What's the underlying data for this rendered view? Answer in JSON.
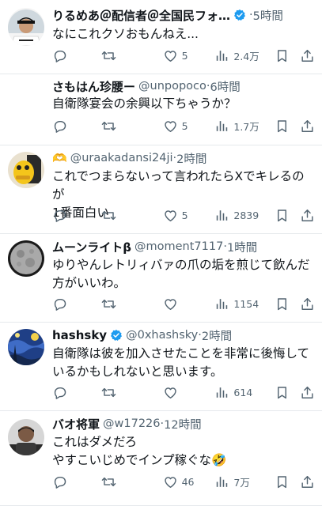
{
  "tweets": [
    {
      "name": "りるめあ＠配信者＠全国民フォ…",
      "verified": true,
      "name_emoji": "",
      "handle": "",
      "dot": "·",
      "time": "5時間",
      "text": "なにこれクソおもんねえ...",
      "replies": "",
      "retweets": "",
      "likes": "5",
      "views": "2.4万",
      "avatar_icon": "anime-character-avatar"
    },
    {
      "name": "さもはん珍腰ー",
      "verified": false,
      "name_emoji": "",
      "handle": "@unpopoco",
      "dot": "·",
      "time": "6時間",
      "text": "自衛隊宴会の余興以下ちゃうか？",
      "replies": "",
      "retweets": "",
      "likes": "5",
      "views": "1.7万",
      "avatar_icon": "baseball-player-avatar"
    },
    {
      "name": "",
      "verified": false,
      "name_emoji": "🫶",
      "handle": "@uraakadansi24ji",
      "dot": "·",
      "time": "2時間",
      "text": "これでつまらないって言われたらXでキレるのが\n1番面白い",
      "replies": "",
      "retweets": "",
      "likes": "5",
      "views": "2839",
      "avatar_icon": "yellow-character-avatar"
    },
    {
      "name": "ムーンライトβ",
      "verified": false,
      "name_emoji": "",
      "handle": "@moment7117",
      "dot": "·",
      "time": "1時間",
      "text": "ゆりやんレトリィバァの爪の垢を煎じて飲んだ\n方がいいわ。",
      "replies": "",
      "retweets": "",
      "likes": "",
      "views": "1154",
      "avatar_icon": "moon-avatar"
    },
    {
      "name": "hashsky",
      "verified": true,
      "name_emoji": "",
      "handle": "@0xhashsky",
      "dot": "·",
      "time": "2時間",
      "text": "自衛隊は彼を加入させたことを非常に後悔して\nいるかもしれないと思います。",
      "replies": "",
      "retweets": "",
      "likes": "",
      "views": "614",
      "avatar_icon": "starry-night-avatar"
    },
    {
      "name": "バオ将軍",
      "verified": false,
      "name_emoji": "",
      "handle": "@w17226",
      "dot": "·",
      "time": "12時間",
      "text": "これはダメだろ\nやすこいじめでインプ稼ぐな🤣",
      "replies": "",
      "retweets": "",
      "likes": "46",
      "views": "7万",
      "avatar_icon": "man-avatar"
    }
  ],
  "colors": {
    "verified": "#1d9bf0",
    "muted": "#536471",
    "text": "#0f1419",
    "divider": "#e6e9ec"
  }
}
